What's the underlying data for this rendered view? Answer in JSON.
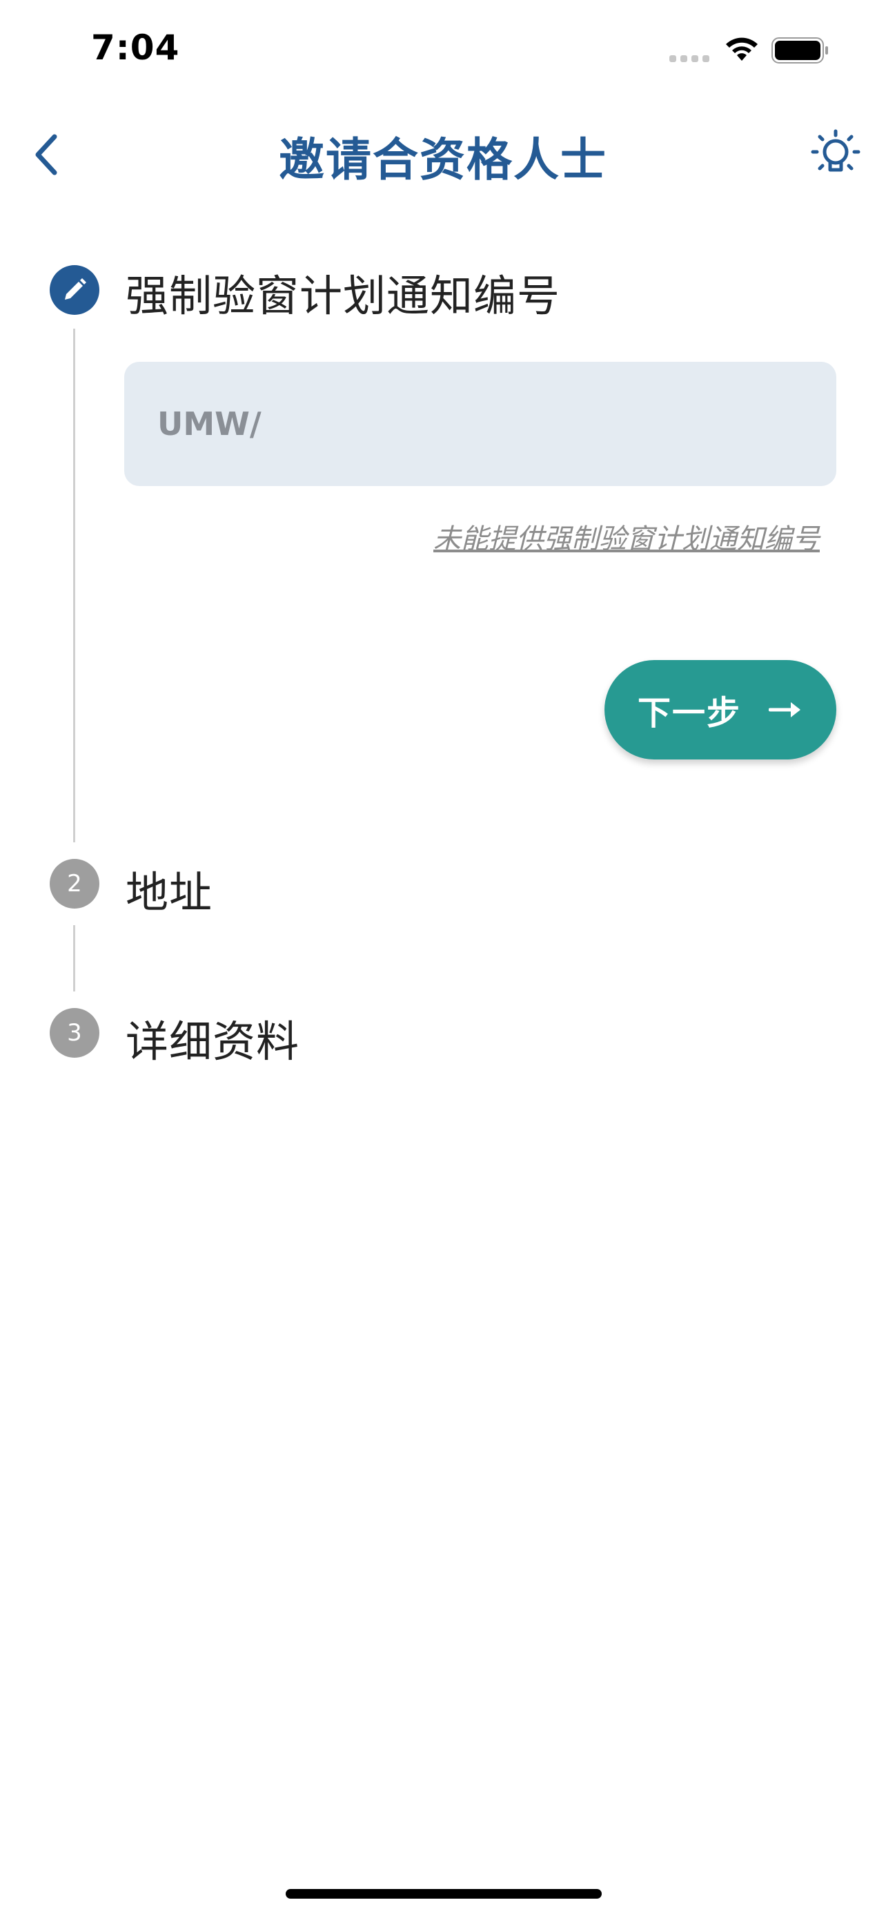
{
  "status_bar": {
    "time": "7:04"
  },
  "header": {
    "title": "邀请合资格人士",
    "back_icon": "chevron-left-icon",
    "hint_icon": "lightbulb-icon"
  },
  "steps": [
    {
      "number": "1",
      "title": "强制验窗计划通知编号",
      "state": "active",
      "icon": "pencil-icon"
    },
    {
      "number": "2",
      "title": "地址",
      "state": "inactive"
    },
    {
      "number": "3",
      "title": "详细资料",
      "state": "inactive"
    }
  ],
  "form": {
    "notice_number_value": "",
    "notice_number_placeholder": "UMW/",
    "no_number_link": "未能提供强制验窗计划通知编号",
    "next_label": "下一步",
    "next_icon": "arrow-right-icon"
  },
  "colors": {
    "primary": "#245a94",
    "accent": "#279a92",
    "input_bg": "#e4ebf2",
    "inactive_step": "#9e9e9e"
  }
}
